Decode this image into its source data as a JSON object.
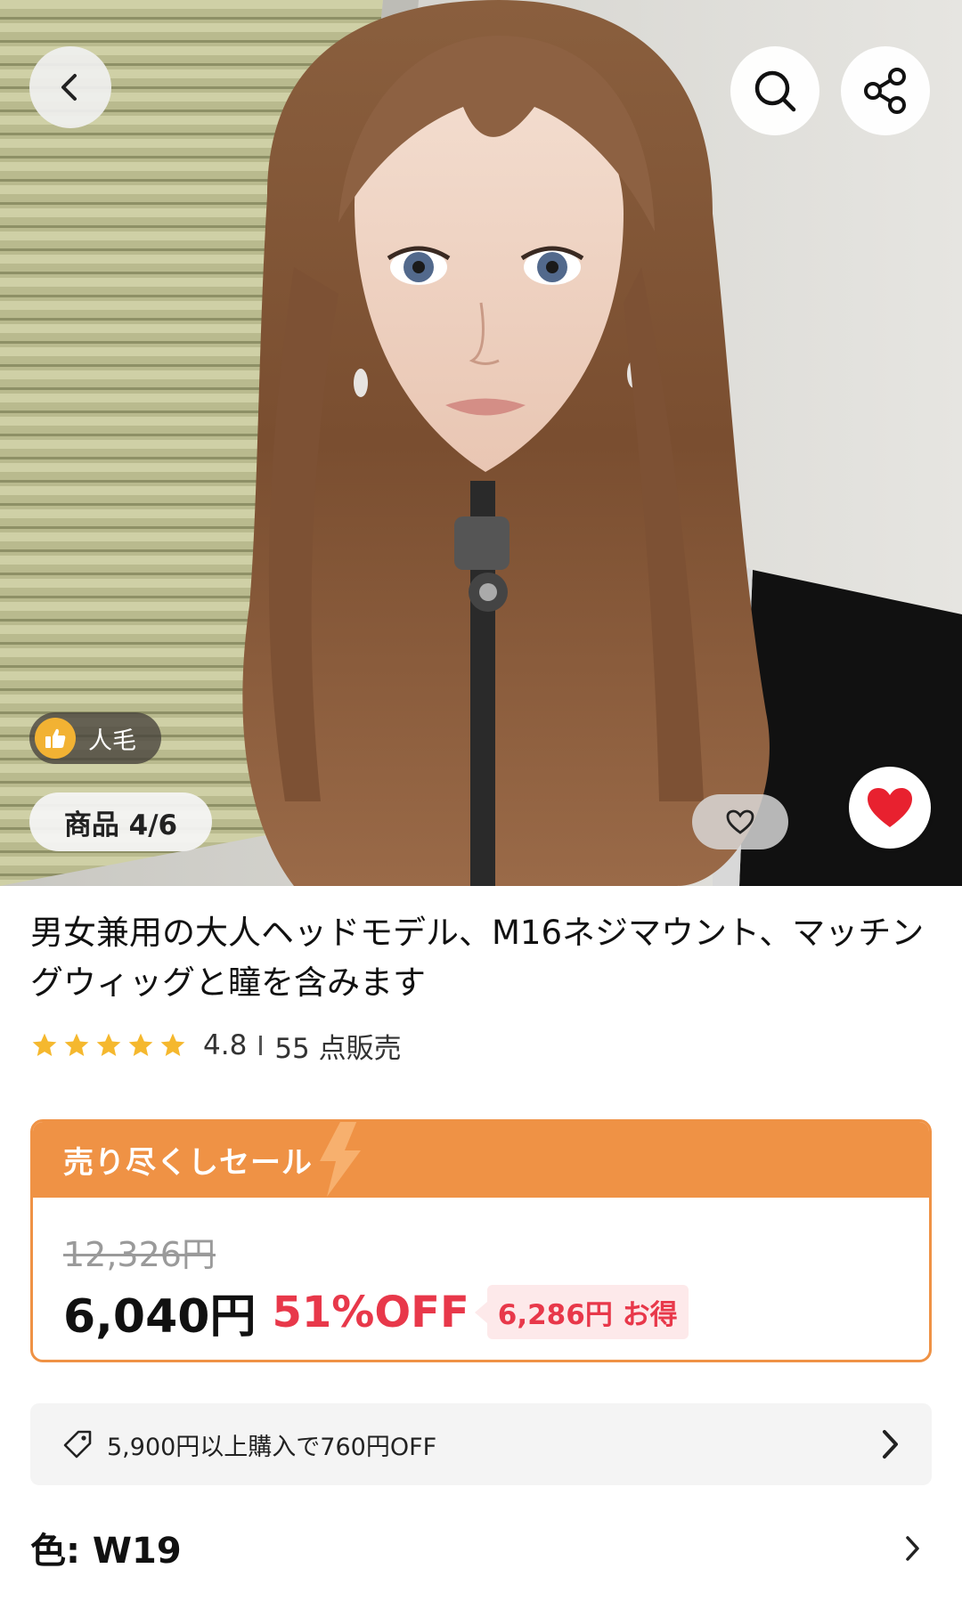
{
  "gallery": {
    "badge_label": "人毛",
    "counter": "商品 4/6"
  },
  "product": {
    "title": "男女兼用の大人ヘッドモデル、M16ネジマウント、マッチングウィッグと瞳を含みます",
    "rating": "4.8",
    "stars": 5,
    "sold": "55 点販売"
  },
  "sale": {
    "label": "売り尽くしセール",
    "original_price": "12,326円",
    "current_price": "6,040円",
    "discount": "51%OFF",
    "savings": "6,286円 お得"
  },
  "coupon": {
    "text": "5,900円以上購入で760円OFF"
  },
  "variant": {
    "color_label": "色: W19"
  },
  "colors": {
    "accent_orange": "#ef9245",
    "price_red": "#e8384a",
    "star_yellow": "#f5b82e",
    "heart_red": "#e8212f"
  },
  "icons": [
    "back-arrow-icon",
    "search-icon",
    "share-icon",
    "thumbs-up-icon",
    "heart-outline-icon",
    "heart-filled-icon",
    "star-icon",
    "lightning-icon",
    "tag-icon",
    "chevron-right-icon"
  ]
}
